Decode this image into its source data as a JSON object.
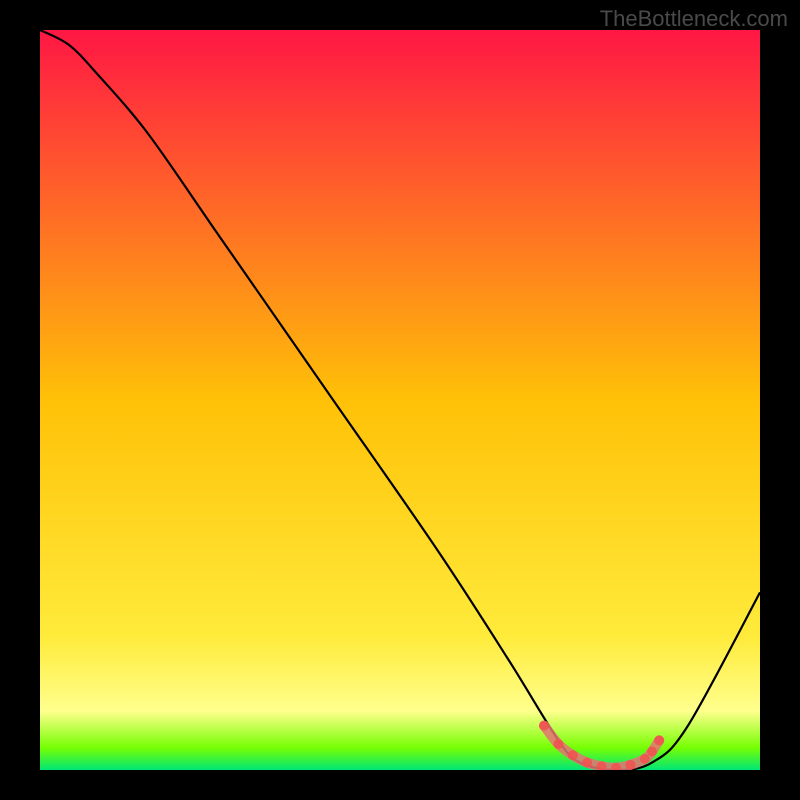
{
  "watermark": "TheBottleneck.com",
  "chart_data": {
    "type": "line",
    "title": "",
    "xlabel": "",
    "ylabel": "",
    "xlim": [
      0,
      100
    ],
    "ylim": [
      0,
      100
    ],
    "gradient_stops": [
      {
        "offset": 0,
        "color": "#ff1744"
      },
      {
        "offset": 0.5,
        "color": "#ffc107"
      },
      {
        "offset": 0.82,
        "color": "#ffeb3b"
      },
      {
        "offset": 0.92,
        "color": "#ffff8d"
      },
      {
        "offset": 0.97,
        "color": "#76ff03"
      },
      {
        "offset": 1.0,
        "color": "#00e676"
      }
    ],
    "series": [
      {
        "name": "bottleneck-curve",
        "x": [
          0,
          4,
          8,
          15,
          25,
          40,
          55,
          65,
          72,
          75,
          80,
          85,
          90,
          100
        ],
        "y": [
          100,
          98,
          94,
          86,
          72,
          51,
          30,
          15,
          4,
          1,
          0,
          1,
          6,
          24
        ]
      }
    ],
    "highlight": {
      "name": "optimal-range",
      "x": [
        70,
        72,
        74,
        76,
        78,
        80,
        82,
        84,
        85,
        86
      ],
      "y": [
        6,
        3.5,
        2,
        1,
        0.5,
        0.3,
        0.7,
        1.5,
        2.5,
        4
      ]
    }
  }
}
